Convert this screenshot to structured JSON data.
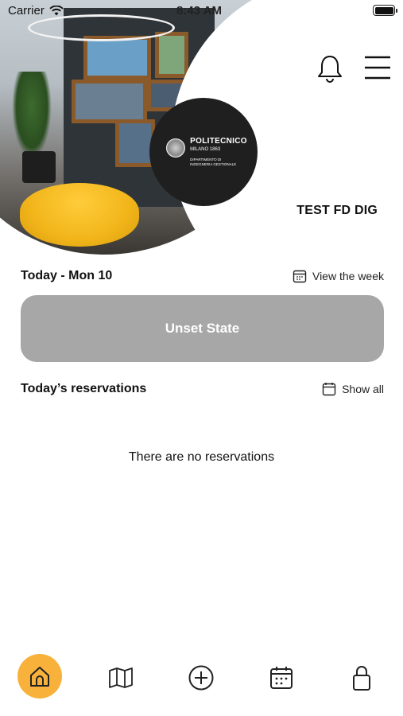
{
  "status_bar": {
    "carrier": "Carrier",
    "time": "8:43 AM"
  },
  "logo": {
    "title": "POLITECNICO",
    "subtitle": "MILANO 1863",
    "department_line1": "DIPARTIMENTO DI",
    "department_line2": "INGEGNERIA GESTIONALE"
  },
  "header": {
    "user_name": "TEST FD DIG"
  },
  "today": {
    "label": "Today - Mon 10",
    "view_week_label": "View the week"
  },
  "state_button": {
    "label": "Unset State",
    "color": "#a7a7a7"
  },
  "reservations": {
    "title": "Today’s reservations",
    "show_all_label": "Show all",
    "empty_message": "There are no reservations"
  },
  "bottom_nav": {
    "accent": "#f8b23b",
    "items": [
      {
        "icon": "home-icon",
        "active": true
      },
      {
        "icon": "map-icon",
        "active": false
      },
      {
        "icon": "add-circle-icon",
        "active": false
      },
      {
        "icon": "calendar-icon",
        "active": false
      },
      {
        "icon": "lock-icon",
        "active": false
      }
    ]
  }
}
